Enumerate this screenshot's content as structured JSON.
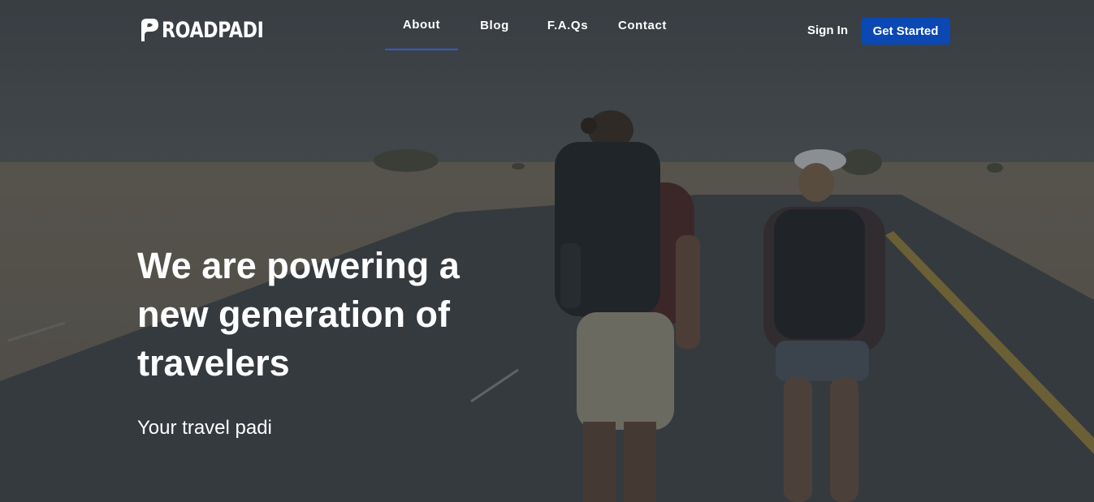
{
  "brand": {
    "name": "ROADPADI"
  },
  "nav": {
    "links": [
      {
        "label": "About",
        "active": true
      },
      {
        "label": "Blog"
      },
      {
        "label": "F.A.Qs"
      },
      {
        "label": "Contact"
      }
    ],
    "sign_in_label": "Sign In",
    "cta_label": "Get Started"
  },
  "hero": {
    "headline": "We are powering a new generation of travelers",
    "subtitle": "Your travel padi"
  },
  "colors": {
    "accent": "#0b48b3",
    "active_underline": "#2f5bd0",
    "overlay": "#1c2126"
  }
}
